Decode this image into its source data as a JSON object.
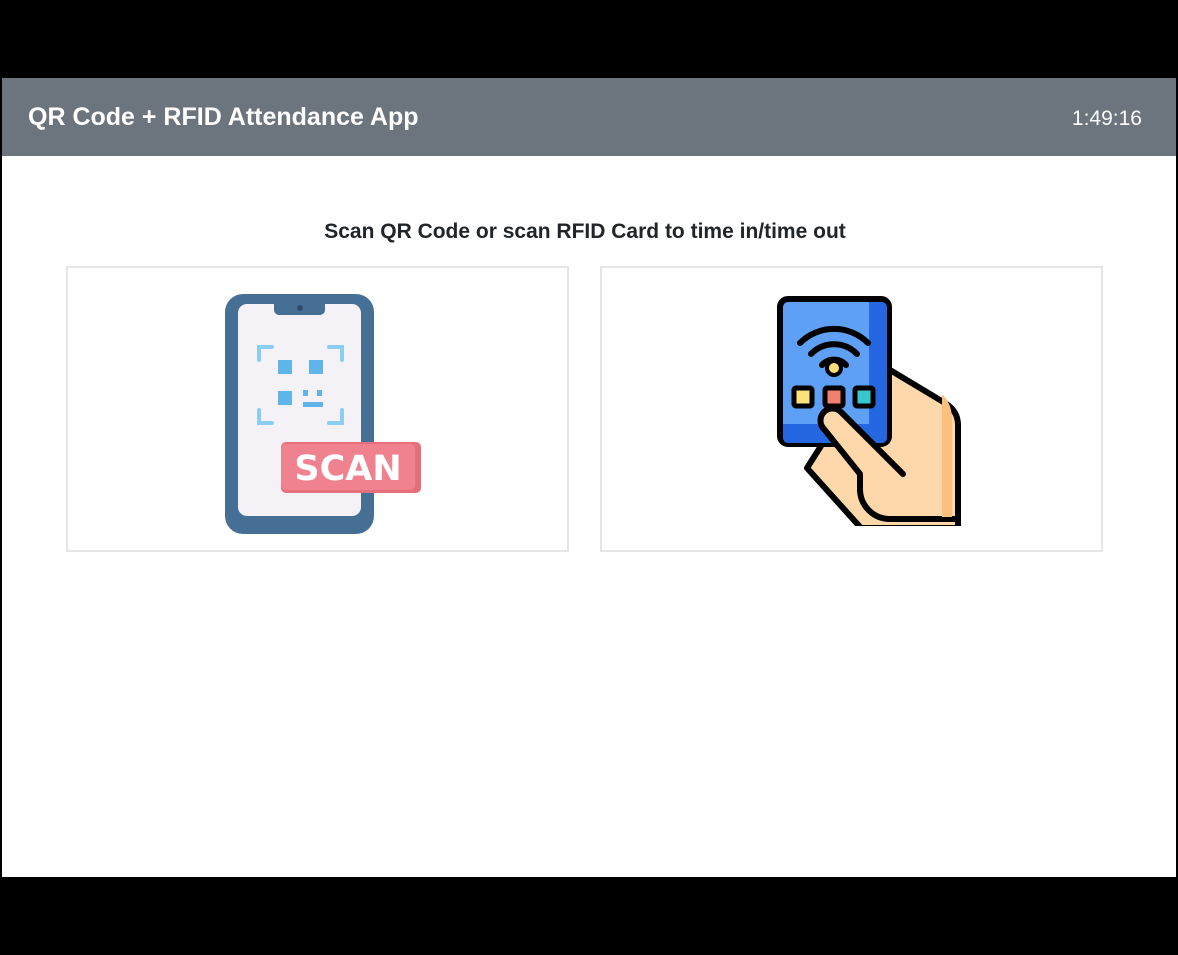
{
  "header": {
    "title": "QR Code + RFID Attendance App",
    "clock": "1:49:16"
  },
  "main": {
    "instruction": "Scan QR Code or scan RFID Card to time in/time out",
    "options": [
      {
        "icon": "qr-scan-phone-icon",
        "badge_text": "SCAN"
      },
      {
        "icon": "rfid-card-hand-icon"
      }
    ]
  },
  "colors": {
    "navbar": "#6c757d",
    "phone_frame": "#456f94",
    "scan_badge": "#f0828f",
    "rfid_card": "#3b7cf0",
    "hand": "#fed8aa"
  }
}
